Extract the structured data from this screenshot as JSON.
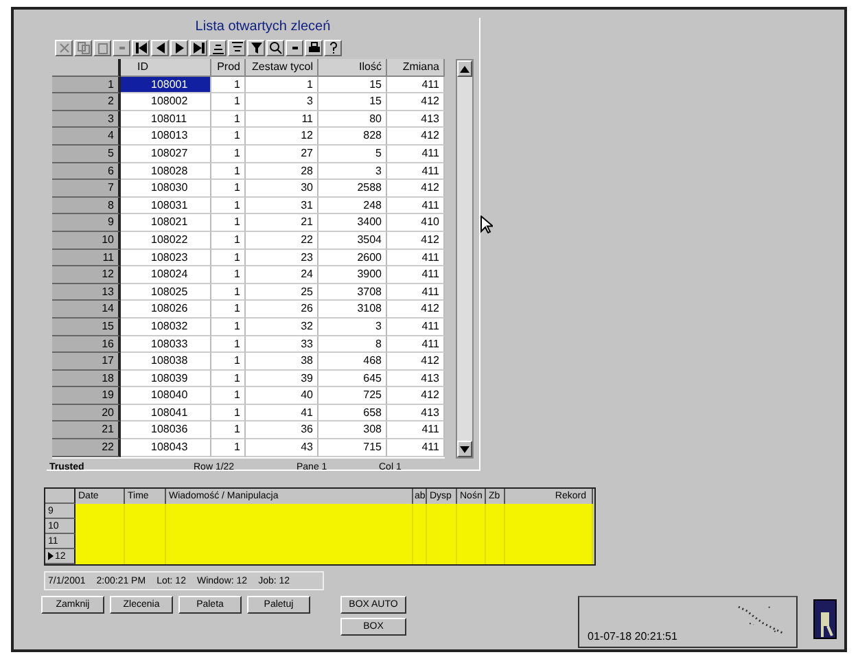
{
  "window": {
    "title": "Lista otwartych zleceń"
  },
  "toolbar": [
    {
      "kind": "cut",
      "disabled": true
    },
    {
      "kind": "copy",
      "disabled": true
    },
    {
      "kind": "paste",
      "disabled": true
    },
    {
      "kind": "blank",
      "disabled": true
    },
    {
      "kind": "first",
      "disabled": false
    },
    {
      "kind": "prev",
      "disabled": false
    },
    {
      "kind": "next",
      "disabled": false
    },
    {
      "kind": "last",
      "disabled": false
    },
    {
      "kind": "sortasc",
      "disabled": false
    },
    {
      "kind": "sortdesc",
      "disabled": false
    },
    {
      "kind": "filter",
      "disabled": false
    },
    {
      "kind": "find",
      "disabled": false
    },
    {
      "kind": "blank",
      "disabled": false
    },
    {
      "kind": "print",
      "disabled": false
    },
    {
      "kind": "help",
      "disabled": false
    }
  ],
  "table": {
    "columns": [
      "ID",
      "Prod",
      "Zestaw tycol",
      "Ilość",
      "Zmiana"
    ],
    "rows": [
      {
        "label": "1",
        "cells": [
          "108001",
          "1",
          "1",
          "15",
          "411"
        ],
        "selected": true
      },
      {
        "label": "2",
        "cells": [
          "108002",
          "1",
          "3",
          "15",
          "412"
        ],
        "selected": false
      },
      {
        "label": "3",
        "cells": [
          "108011",
          "1",
          "11",
          "80",
          "413"
        ],
        "selected": false
      },
      {
        "label": "4",
        "cells": [
          "108013",
          "1",
          "12",
          "828",
          "412"
        ],
        "selected": false
      },
      {
        "label": "5",
        "cells": [
          "108027",
          "1",
          "27",
          "5",
          "411"
        ],
        "selected": false
      },
      {
        "label": "6",
        "cells": [
          "108028",
          "1",
          "28",
          "3",
          "411"
        ],
        "selected": false
      },
      {
        "label": "7",
        "cells": [
          "108030",
          "1",
          "30",
          "2588",
          "412"
        ],
        "selected": false
      },
      {
        "label": "8",
        "cells": [
          "108031",
          "1",
          "31",
          "248",
          "411"
        ],
        "selected": false
      },
      {
        "label": "9",
        "cells": [
          "108021",
          "1",
          "21",
          "3400",
          "410"
        ],
        "selected": false
      },
      {
        "label": "10",
        "cells": [
          "108022",
          "1",
          "22",
          "3504",
          "412"
        ],
        "selected": false
      },
      {
        "label": "11",
        "cells": [
          "108023",
          "1",
          "23",
          "2600",
          "411"
        ],
        "selected": false
      },
      {
        "label": "12",
        "cells": [
          "108024",
          "1",
          "24",
          "3900",
          "411"
        ],
        "selected": false
      },
      {
        "label": "13",
        "cells": [
          "108025",
          "1",
          "25",
          "3708",
          "411"
        ],
        "selected": false
      },
      {
        "label": "14",
        "cells": [
          "108026",
          "1",
          "26",
          "3108",
          "412"
        ],
        "selected": false
      },
      {
        "label": "15",
        "cells": [
          "108032",
          "1",
          "32",
          "3",
          "411"
        ],
        "selected": false
      },
      {
        "label": "16",
        "cells": [
          "108033",
          "1",
          "33",
          "8",
          "411"
        ],
        "selected": false
      },
      {
        "label": "17",
        "cells": [
          "108038",
          "1",
          "38",
          "468",
          "412"
        ],
        "selected": false
      },
      {
        "label": "18",
        "cells": [
          "108039",
          "1",
          "39",
          "645",
          "413"
        ],
        "selected": false
      },
      {
        "label": "19",
        "cells": [
          "108040",
          "1",
          "40",
          "725",
          "412"
        ],
        "selected": false
      },
      {
        "label": "20",
        "cells": [
          "108041",
          "1",
          "41",
          "658",
          "413"
        ],
        "selected": false
      },
      {
        "label": "21",
        "cells": [
          "108036",
          "1",
          "36",
          "308",
          "411"
        ],
        "selected": false
      },
      {
        "label": "22",
        "cells": [
          "108043",
          "1",
          "43",
          "715",
          "411"
        ],
        "selected": false
      }
    ],
    "status": [
      "Trusted",
      "Row 1/22",
      "Pane 1",
      "Col 1"
    ]
  },
  "log": {
    "columns": [
      "Date",
      "Time",
      "Wiadomość / Manipulacja",
      "ab",
      "Dysp",
      "Nośn",
      "Zb",
      "Rekord"
    ],
    "rows": [
      {
        "label": "9",
        "current": false
      },
      {
        "label": "10",
        "current": false
      },
      {
        "label": "11",
        "current": false
      },
      {
        "label": "12",
        "current": true
      }
    ]
  },
  "status_bar": [
    "7/1/2001",
    "2:00:21 PM",
    "Lot: 12",
    "Window: 12",
    "Job: 12"
  ],
  "buttons": [
    "Zamknij",
    "Zlecenia",
    "Paleta",
    "Paletuj"
  ],
  "box_buttons": [
    "BOX AUTO",
    "BOX"
  ],
  "clock": "01-07-18 20:21:51"
}
